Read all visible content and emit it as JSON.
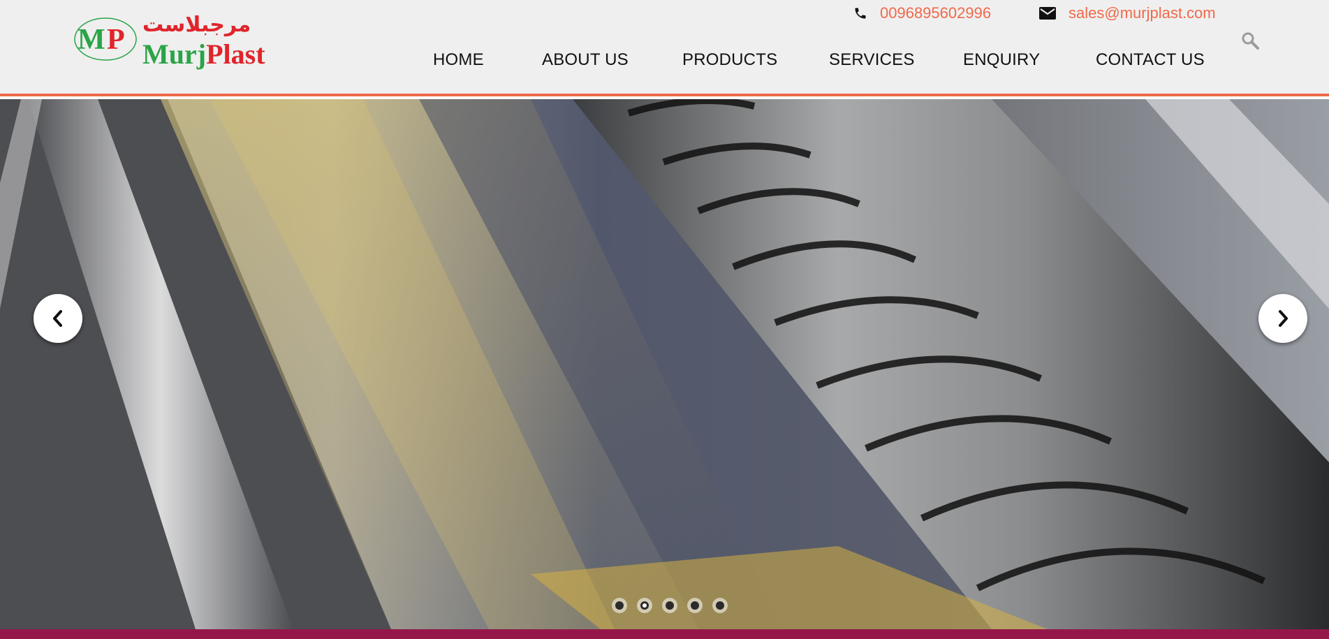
{
  "logo": {
    "arabic_text": "مرجبلاست",
    "mark_text": "MP",
    "name_part1": "Murj",
    "name_part2": "Plast"
  },
  "contact": {
    "phone": "0096895602996",
    "email": "sales@murjplast.com",
    "phone_icon": "phone-icon",
    "email_icon": "envelope-icon"
  },
  "search": {
    "icon": "search-icon"
  },
  "nav": {
    "items": [
      {
        "label": "HOME"
      },
      {
        "label": "ABOUT US"
      },
      {
        "label": "PRODUCTS"
      },
      {
        "label": "SERVICES"
      },
      {
        "label": "ENQUIRY"
      },
      {
        "label": "CONTACT US"
      }
    ]
  },
  "slider": {
    "prev_icon": "chevron-left-icon",
    "next_icon": "chevron-right-icon",
    "slide_count": 5,
    "active_slide": 2
  },
  "colors": {
    "accent": "#f0694a",
    "brand_green": "#2aa447",
    "brand_red": "#e0242b",
    "header_bg": "#efefef",
    "footer_bar": "#95174a"
  }
}
